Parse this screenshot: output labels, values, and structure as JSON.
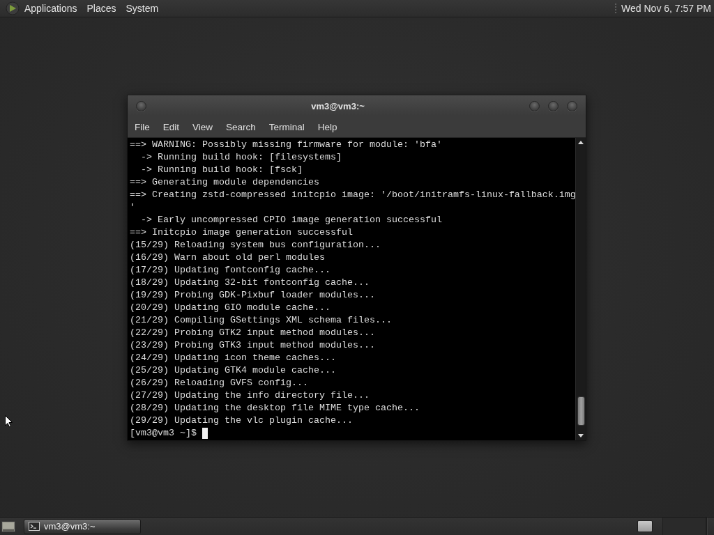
{
  "top_panel": {
    "menus": [
      {
        "label": "Applications"
      },
      {
        "label": "Places"
      },
      {
        "label": "System"
      }
    ],
    "clock": "Wed Nov 6, 7:57 PM"
  },
  "terminal_window": {
    "title": "vm3@vm3:~",
    "menu": [
      "File",
      "Edit",
      "View",
      "Search",
      "Terminal",
      "Help"
    ],
    "lines": [
      "==> WARNING: Possibly missing firmware for module: 'bfa'",
      "  -> Running build hook: [filesystems]",
      "  -> Running build hook: [fsck]",
      "==> Generating module dependencies",
      "==> Creating zstd-compressed initcpio image: '/boot/initramfs-linux-fallback.img",
      "'",
      "  -> Early uncompressed CPIO image generation successful",
      "==> Initcpio image generation successful",
      "(15/29) Reloading system bus configuration...",
      "(16/29) Warn about old perl modules",
      "(17/29) Updating fontconfig cache...",
      "(18/29) Updating 32-bit fontconfig cache...",
      "(19/29) Probing GDK-Pixbuf loader modules...",
      "(20/29) Updating GIO module cache...",
      "(21/29) Compiling GSettings XML schema files...",
      "(22/29) Probing GTK2 input method modules...",
      "(23/29) Probing GTK3 input method modules...",
      "(24/29) Updating icon theme caches...",
      "(25/29) Updating GTK4 module cache...",
      "(26/29) Reloading GVFS config...",
      "(27/29) Updating the info directory file...",
      "(28/29) Updating the desktop file MIME type cache...",
      "(29/29) Updating the vlc plugin cache..."
    ],
    "prompt": "[vm3@vm3 ~]$"
  },
  "bottom_panel": {
    "taskbar": {
      "label": "vm3@vm3:~"
    }
  }
}
